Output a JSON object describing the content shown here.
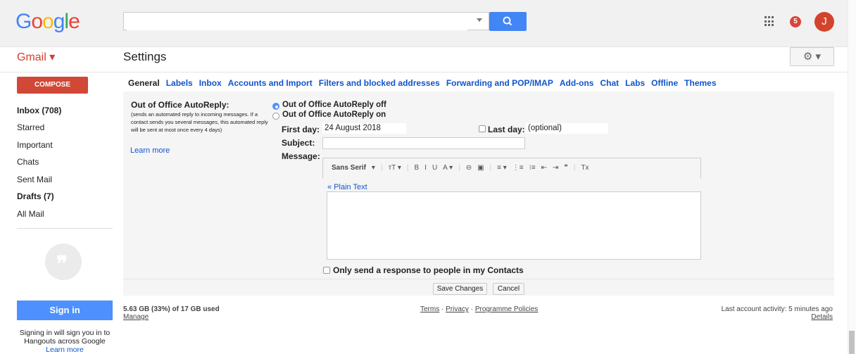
{
  "header": {
    "logo_letters": [
      {
        "ch": "G",
        "color": "#4285f4"
      },
      {
        "ch": "o",
        "color": "#ea4335"
      },
      {
        "ch": "o",
        "color": "#fbbc05"
      },
      {
        "ch": "g",
        "color": "#4285f4"
      },
      {
        "ch": "l",
        "color": "#34a853"
      },
      {
        "ch": "e",
        "color": "#ea4335"
      }
    ],
    "search_value": "",
    "notification_count": "5",
    "avatar_initial": "J"
  },
  "subheader": {
    "app_label": "Gmail ▾",
    "page_title": "Settings",
    "gear": "⚙ ▾"
  },
  "sidebar": {
    "compose": "COMPOSE",
    "items": [
      {
        "label": "Inbox (708)",
        "bold": true
      },
      {
        "label": "Starred",
        "bold": false
      },
      {
        "label": "Important",
        "bold": false
      },
      {
        "label": "Chats",
        "bold": false
      },
      {
        "label": "Sent Mail",
        "bold": false
      },
      {
        "label": "Drafts (7)",
        "bold": true
      },
      {
        "label": "All Mail",
        "bold": false
      }
    ],
    "hangouts_quote": "❞",
    "sign_in": "Sign in",
    "sign_in_text": "Signing in will sign you in to Hangouts across Google",
    "learn_more": "Learn more"
  },
  "tabs": [
    {
      "label": "General",
      "active": true
    },
    {
      "label": "Labels",
      "active": false
    },
    {
      "label": "Inbox",
      "active": false
    },
    {
      "label": "Accounts and Import",
      "active": false
    },
    {
      "label": "Filters and blocked addresses",
      "active": false
    },
    {
      "label": "Forwarding and POP/IMAP",
      "active": false
    },
    {
      "label": "Add-ons",
      "active": false
    },
    {
      "label": "Chat",
      "active": false
    },
    {
      "label": "Labs",
      "active": false
    },
    {
      "label": "Offline",
      "active": false
    },
    {
      "label": "Themes",
      "active": false
    }
  ],
  "autoreply": {
    "title": "Out of Office AutoReply:",
    "description": "(sends an automated reply to incoming messages. If a contact sends you several messages, this automated reply will be sent at most once every 4 days)",
    "learn_more": "Learn more",
    "option_off": "Out of Office AutoReply off",
    "option_on": "Out of Office AutoReply on",
    "selected": "off",
    "first_day_label": "First day:",
    "first_day_value": "24 August 2018",
    "last_day_label": "Last day:",
    "last_day_value": "(optional)",
    "subject_label": "Subject:",
    "subject_value": "",
    "message_label": "Message:",
    "toolbar": {
      "font": "Sans Serif",
      "items": [
        "▾",
        "|",
        "тT ▾",
        "|",
        "B",
        "I",
        "U",
        "A ▾",
        "|",
        "⊖",
        "▣",
        "|",
        "≡ ▾",
        "⋮≡",
        "⁝≡",
        "⇤",
        "⇥",
        "❞",
        "|",
        "Tx"
      ]
    },
    "plain_text": "« Plain Text",
    "message_value": "",
    "contacts_only": "Only send a response to people in my Contacts",
    "save": "Save Changes",
    "cancel": "Cancel"
  },
  "footer": {
    "storage": "5.63 GB (33%) of 17 GB used",
    "manage": "Manage",
    "terms": "Terms",
    "privacy": "Privacy",
    "policies": "Programme Policies",
    "sep": " · ",
    "activity": "Last account activity: 5 minutes ago",
    "details": "Details"
  }
}
